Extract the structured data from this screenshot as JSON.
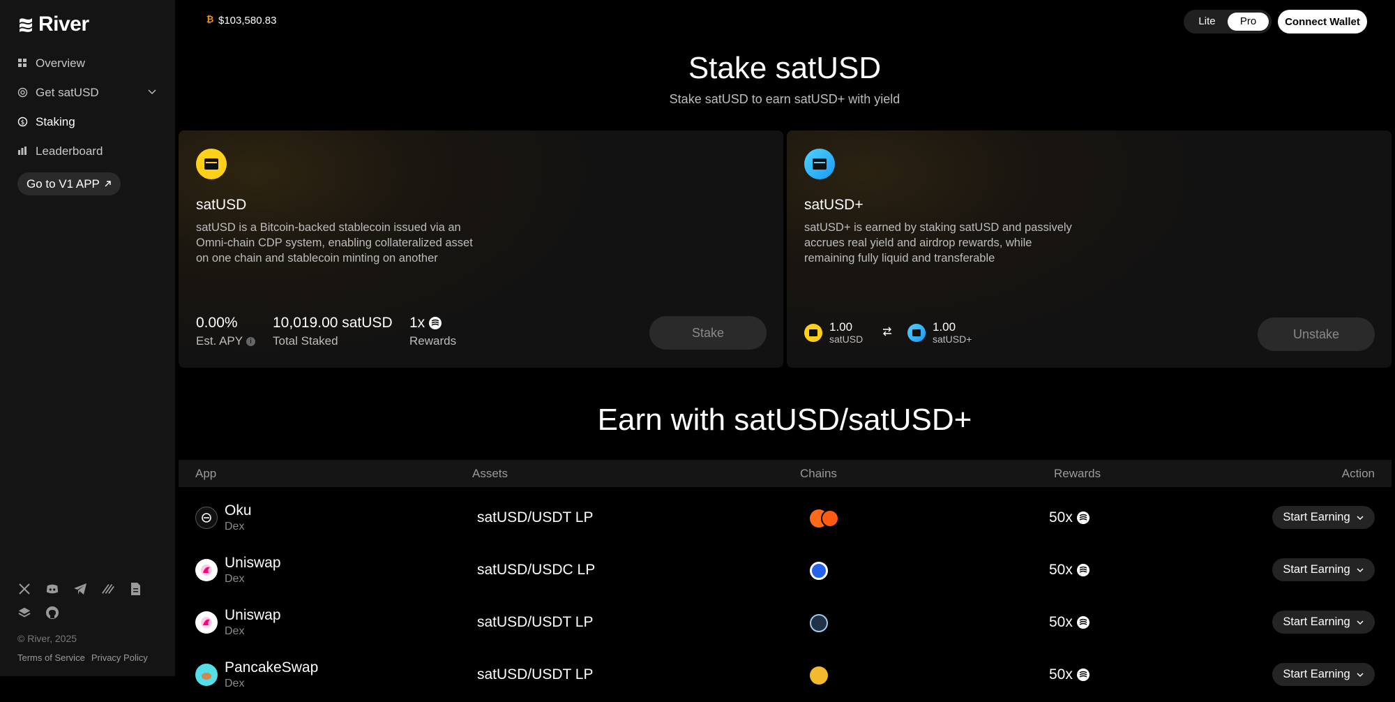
{
  "brand": {
    "name": "River"
  },
  "sidebar": {
    "items": [
      {
        "label": "Overview",
        "icon": "grid-icon",
        "active": false
      },
      {
        "label": "Get satUSD",
        "icon": "target-icon",
        "active": false,
        "has_submenu": true
      },
      {
        "label": "Staking",
        "icon": "dollar-circle-icon",
        "active": true
      },
      {
        "label": "Leaderboard",
        "icon": "bars-icon",
        "active": false
      }
    ],
    "v1_button": "Go to V1 APP",
    "socials": [
      "x-icon",
      "discord-icon",
      "telegram-icon",
      "mirror-icon",
      "docs-icon",
      "stack-icon",
      "github-icon"
    ],
    "copyright": "© River, 2025",
    "links": [
      "Terms of Service",
      "Privacy Policy"
    ]
  },
  "header": {
    "btc_price": "$103,580.83",
    "mode": {
      "options": [
        "Lite",
        "Pro"
      ],
      "selected": "Pro"
    },
    "connect_wallet": "Connect Wallet"
  },
  "hero": {
    "title": "Stake satUSD",
    "subtitle": "Stake satUSD to earn satUSD+ with yield"
  },
  "cards": {
    "satusd": {
      "title": "satUSD",
      "description": "satUSD is a Bitcoin-backed stablecoin issued via an Omni-chain CDP system, enabling collateralized asset on one chain and stablecoin minting on another",
      "apy": "0.00%",
      "apy_label": "Est. APY",
      "total_staked": "10,019.00 satUSD",
      "total_staked_label": "Total Staked",
      "rewards": "1x",
      "rewards_label": "Rewards",
      "button": "Stake"
    },
    "satusd_plus": {
      "title": "satUSD+",
      "description": "satUSD+ is earned by staking satUSD and passively accrues real yield and airdrop rewards, while remaining fully liquid and transferable",
      "from_value": "1.00",
      "from_label": "satUSD",
      "to_value": "1.00",
      "to_label": "satUSD+",
      "button": "Unstake"
    }
  },
  "earn": {
    "title": "Earn with satUSD/satUSD+",
    "columns": [
      "App",
      "Assets",
      "Chains",
      "Rewards",
      "Action"
    ],
    "rows": [
      {
        "app": "Oku",
        "type": "Dex",
        "asset": "satUSD/USDT LP",
        "reward": "50x",
        "action": "Start Earning",
        "chain_colors": [
          "#ff6a1a",
          "#ff5a14"
        ]
      },
      {
        "app": "Uniswap",
        "type": "Dex",
        "asset": "satUSD/USDC LP",
        "reward": "50x",
        "action": "Start Earning",
        "chain_colors": [
          "#2563eb"
        ]
      },
      {
        "app": "Uniswap",
        "type": "Dex",
        "asset": "satUSD/USDT LP",
        "reward": "50x",
        "action": "Start Earning",
        "chain_colors": [
          "#213147"
        ]
      },
      {
        "app": "PancakeSwap",
        "type": "Dex",
        "asset": "satUSD/USDT LP",
        "reward": "50x",
        "action": "Start Earning",
        "chain_colors": [
          "#f3ba2f"
        ]
      }
    ]
  }
}
